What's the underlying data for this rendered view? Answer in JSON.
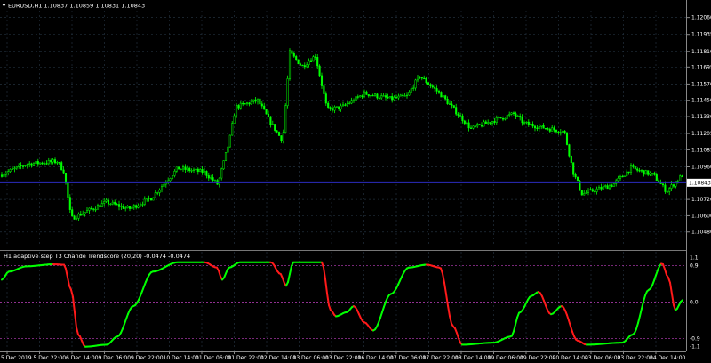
{
  "main": {
    "title": "EURUSD,H1  1.10837 1.10859 1.10831 1.10843",
    "symbol_icon": "triangle-down-icon",
    "price_levels": [
      "1.12060",
      "1.11935",
      "1.11810",
      "1.11695",
      "1.11570",
      "1.11450",
      "1.11330",
      "1.11205",
      "1.11085",
      "1.10960",
      "1.10843",
      "1.10720",
      "1.10600",
      "1.10480"
    ],
    "current_price": "1.10843",
    "colors": {
      "up": "#00ff00",
      "down": "#00ff00",
      "current_line": "#2b2bbf",
      "grid": "#2a3440"
    }
  },
  "indicator": {
    "title": "H1  adaptive step T3 Chande Trendscore (20,20) -0.0474 -0.0474",
    "levels": [
      "1.1",
      "0.9",
      "0.0",
      "-0.9",
      "-1.1"
    ],
    "colors": {
      "rising": "#00ff00",
      "falling": "#ff1a1a",
      "level_dash": "#c040c0"
    }
  },
  "time_axis": [
    "5 Dec 2019",
    "5 Dec 22:00",
    "6 Dec 14:00",
    "9 Dec 06:00",
    "9 Dec 22:00",
    "10 Dec 14:00",
    "11 Dec 06:00",
    "11 Dec 22:00",
    "12 Dec 14:00",
    "13 Dec 06:00",
    "13 Dec 22:00",
    "16 Dec 14:00",
    "17 Dec 06:00",
    "17 Dec 22:00",
    "18 Dec 14:00",
    "19 Dec 06:00",
    "19 Dec 22:00",
    "20 Dec 14:00",
    "23 Dec 06:00",
    "23 Dec 22:00",
    "24 Dec 14:00"
  ]
}
